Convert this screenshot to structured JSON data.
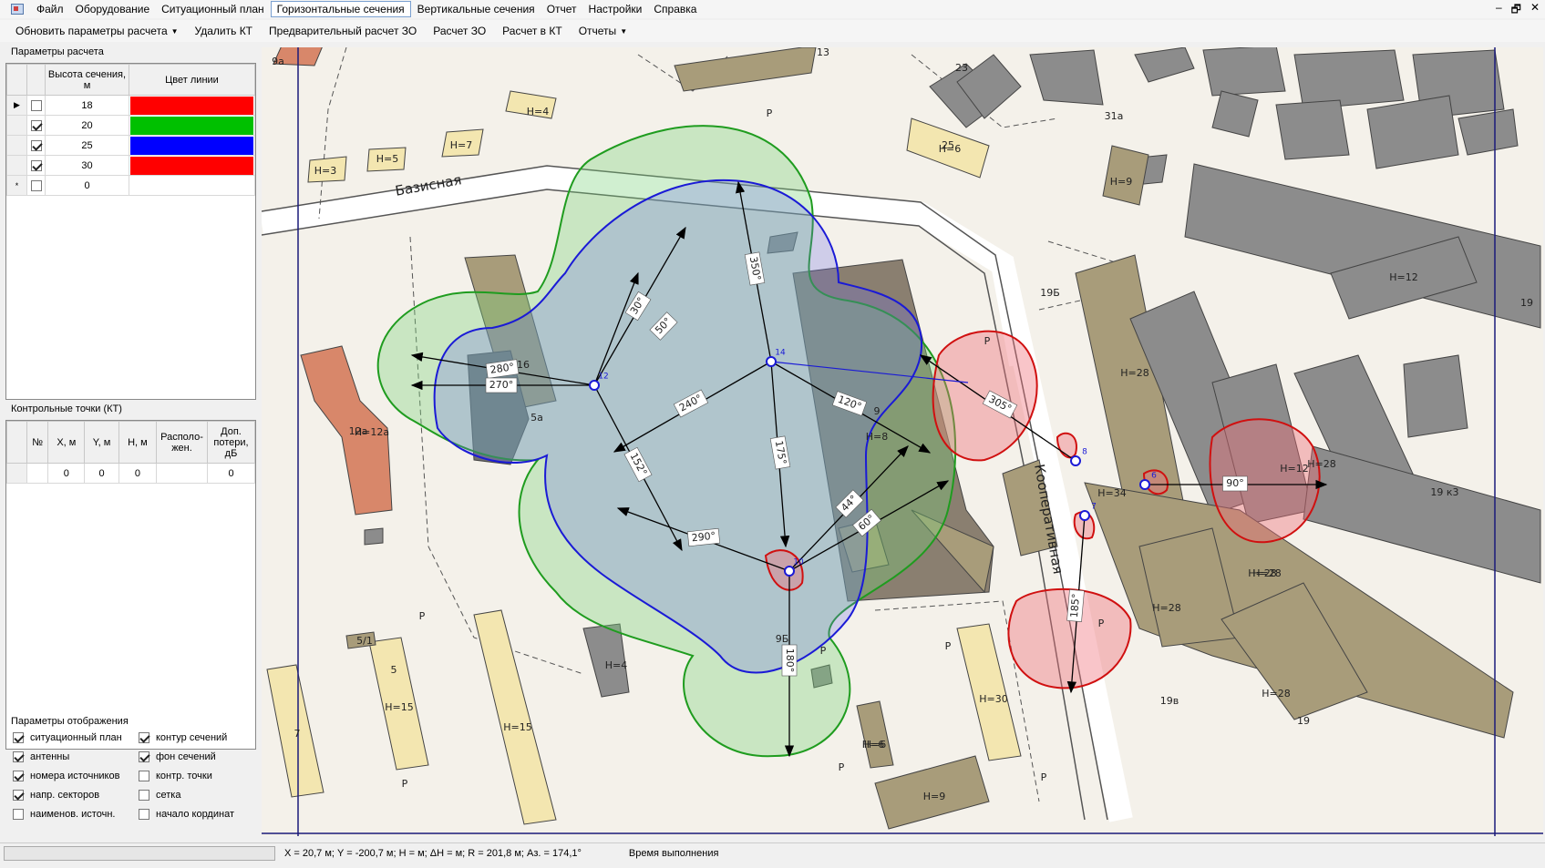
{
  "menu": {
    "items": [
      "Файл",
      "Оборудование",
      "Ситуационный план",
      "Горизонтальные сечения",
      "Вертикальные сечения",
      "Отчет",
      "Настройки",
      "Справка"
    ],
    "active_index": 3,
    "window_controls": [
      "–",
      "🗗",
      "✕"
    ]
  },
  "toolbar": {
    "update_label": "Обновить параметры расчета",
    "delete_kt_label": "Удалить КТ",
    "pre_calc_label": "Предварительный расчет ЗО",
    "calc_label": "Расчет ЗО",
    "calc_kt_label": "Расчет в КТ",
    "reports_label": "Отчеты"
  },
  "calc_params": {
    "title": "Параметры расчета",
    "col_height": "Высота сечения, м",
    "col_color": "Цвет линии",
    "rows": [
      {
        "marker": "▶",
        "checked": false,
        "height": "18",
        "color": "#ff0000"
      },
      {
        "marker": "",
        "checked": true,
        "height": "20",
        "color": "#00c000"
      },
      {
        "marker": "",
        "checked": true,
        "height": "25",
        "color": "#0000ff"
      },
      {
        "marker": "",
        "checked": true,
        "height": "30",
        "color": "#ff0000"
      },
      {
        "marker": "*",
        "checked": false,
        "height": "0",
        "color": "#ffffff"
      }
    ]
  },
  "control_points": {
    "title": "Контрольные точки (КТ)",
    "headers": [
      "№",
      "X, м",
      "Y, м",
      "H, м",
      "Располо-жен.",
      "Доп. потери, дБ"
    ],
    "rows": [
      [
        "",
        "0",
        "0",
        "0",
        "",
        "0"
      ]
    ]
  },
  "display_params": {
    "title": "Параметры отображения",
    "options": [
      {
        "label": "ситуационный план",
        "checked": true
      },
      {
        "label": "контур сечений",
        "checked": true
      },
      {
        "label": "антенны",
        "checked": true
      },
      {
        "label": "фон сечений",
        "checked": true
      },
      {
        "label": "номера источников",
        "checked": true
      },
      {
        "label": "контр. точки",
        "checked": false
      },
      {
        "label": "напр. секторов",
        "checked": true
      },
      {
        "label": "сетка",
        "checked": false
      },
      {
        "label": "наименов. источн.",
        "checked": false
      },
      {
        "label": "начало кординат",
        "checked": false
      }
    ]
  },
  "map": {
    "streets": [
      "Базисная",
      "Кооперативная"
    ],
    "building_labels": [
      "13",
      "23",
      "31а",
      "25",
      "Н=6",
      "9а",
      "Н=9",
      "Н=4",
      "Н=5",
      "Н=7",
      "Н=3",
      "19Б",
      "Н=12",
      "19",
      "Н=28",
      "Н=8",
      "9",
      "Н=34",
      "19 к3",
      "5а",
      "16",
      "12а",
      "Н=12а",
      "5/1",
      "5",
      "Н=15",
      "7",
      "9Б",
      "Н=30",
      "Н=6",
      "Н=9",
      "19в",
      "Н=28",
      "19",
      "Н=28",
      "Н=28",
      "Н=28",
      "Н=4",
      "Н=6",
      "Н=12",
      "Н=28",
      "Р",
      "Р",
      "Р",
      "Р",
      "Р",
      "Р",
      "Р",
      "Р",
      "Р",
      "Н=15"
    ],
    "sector_angles": [
      "30°",
      "50°",
      "350°",
      "280°",
      "270°",
      "240°",
      "152°",
      "120°",
      "175°",
      "305°",
      "90°",
      "44°",
      "60°",
      "290°",
      "180°",
      "185°"
    ],
    "antenna_ids": [
      "12",
      "14",
      "8",
      "6",
      "7",
      "10"
    ]
  },
  "statusbar": {
    "coords": "X = 20,7 м; Y = -200,7 м; H =  м; ΔH =  м; R = 201,8 м; Аз. = 174,1°",
    "exec": "Время выполнения"
  }
}
